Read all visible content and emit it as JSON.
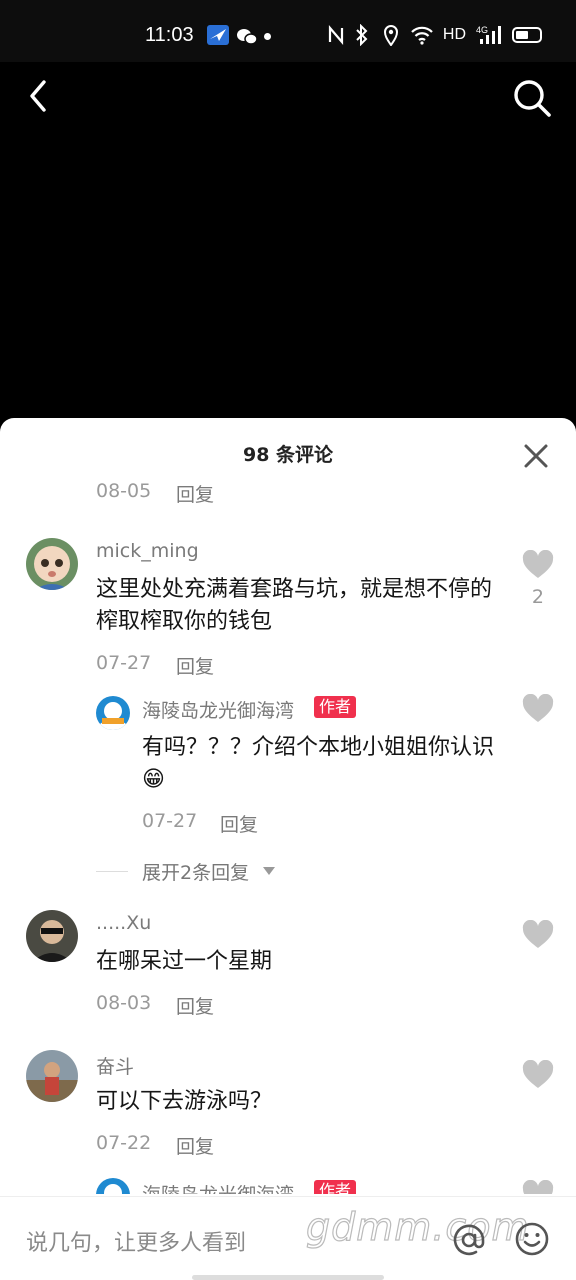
{
  "status_bar": {
    "time": "11:03",
    "network_label": "HD",
    "signal_label": "4G"
  },
  "sheet": {
    "title": "98 条评论"
  },
  "comments": [
    {
      "date": "08-05",
      "reply_label": "回复"
    },
    {
      "username": "mick_ming",
      "text": "这里处处充满着套路与坑，就是想不停的榨取榨取你的钱包",
      "date": "07-27",
      "reply_label": "回复",
      "like_count": "2"
    },
    {
      "username": "海陵岛龙光御海湾",
      "badge": "作者",
      "text": "有吗？？？介绍个本地小姐姐你认识😁",
      "date": "07-27",
      "reply_label": "回复"
    },
    {
      "expand_label": "展开2条回复"
    },
    {
      "username": ".....Xu",
      "text": "在哪呆过一个星期",
      "date": "08-03",
      "reply_label": "回复"
    },
    {
      "username": "奋斗",
      "text": "可以下去游泳吗？",
      "date": "07-22",
      "reply_label": "回复"
    },
    {
      "username": "海陵岛龙光御海湾",
      "badge": "作者"
    }
  ],
  "input": {
    "placeholder": "说几句，让更多人看到"
  },
  "watermark": "gdmm.com",
  "colors": {
    "badge": "#f0304d",
    "like_icon": "#c4c4c4",
    "text_primary": "#161616",
    "text_secondary": "#7a7a7a"
  }
}
